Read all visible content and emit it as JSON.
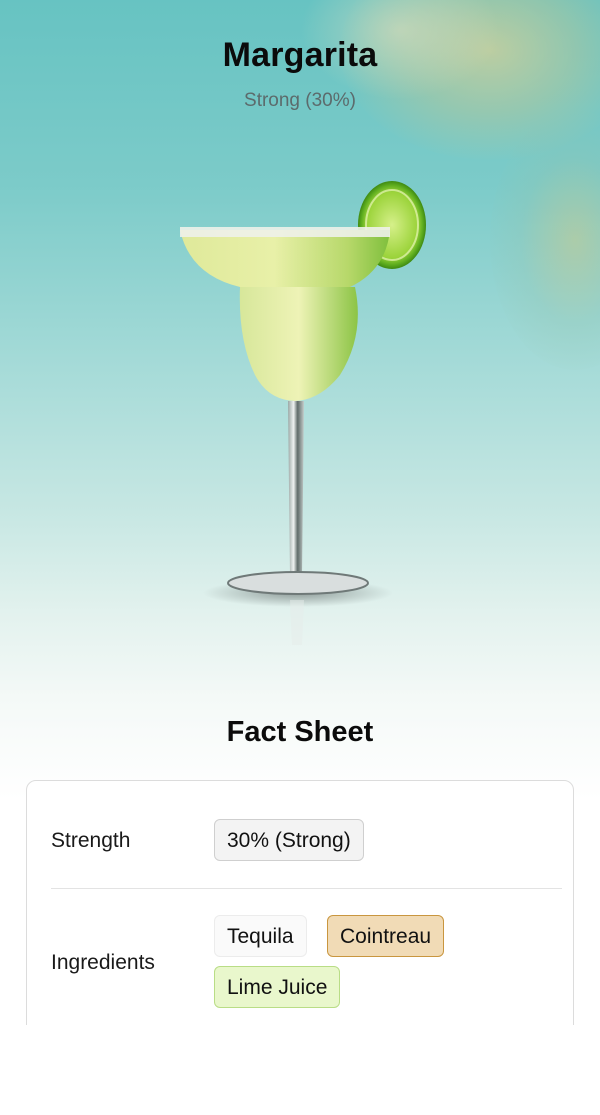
{
  "drink": {
    "name": "Margarita",
    "strength_label": "Strong (30%)"
  },
  "fact_sheet": {
    "title": "Fact Sheet",
    "strength": {
      "label": "Strength",
      "value": "30% (Strong)"
    },
    "ingredients": {
      "label": "Ingredients",
      "items": [
        "Tequila",
        "Cointreau",
        "Lime Juice"
      ]
    }
  },
  "colors": {
    "cointreau_chip": "#f1dbb6",
    "lime_chip": "#e9f7cc",
    "hero_teal": "#67c3c2"
  }
}
